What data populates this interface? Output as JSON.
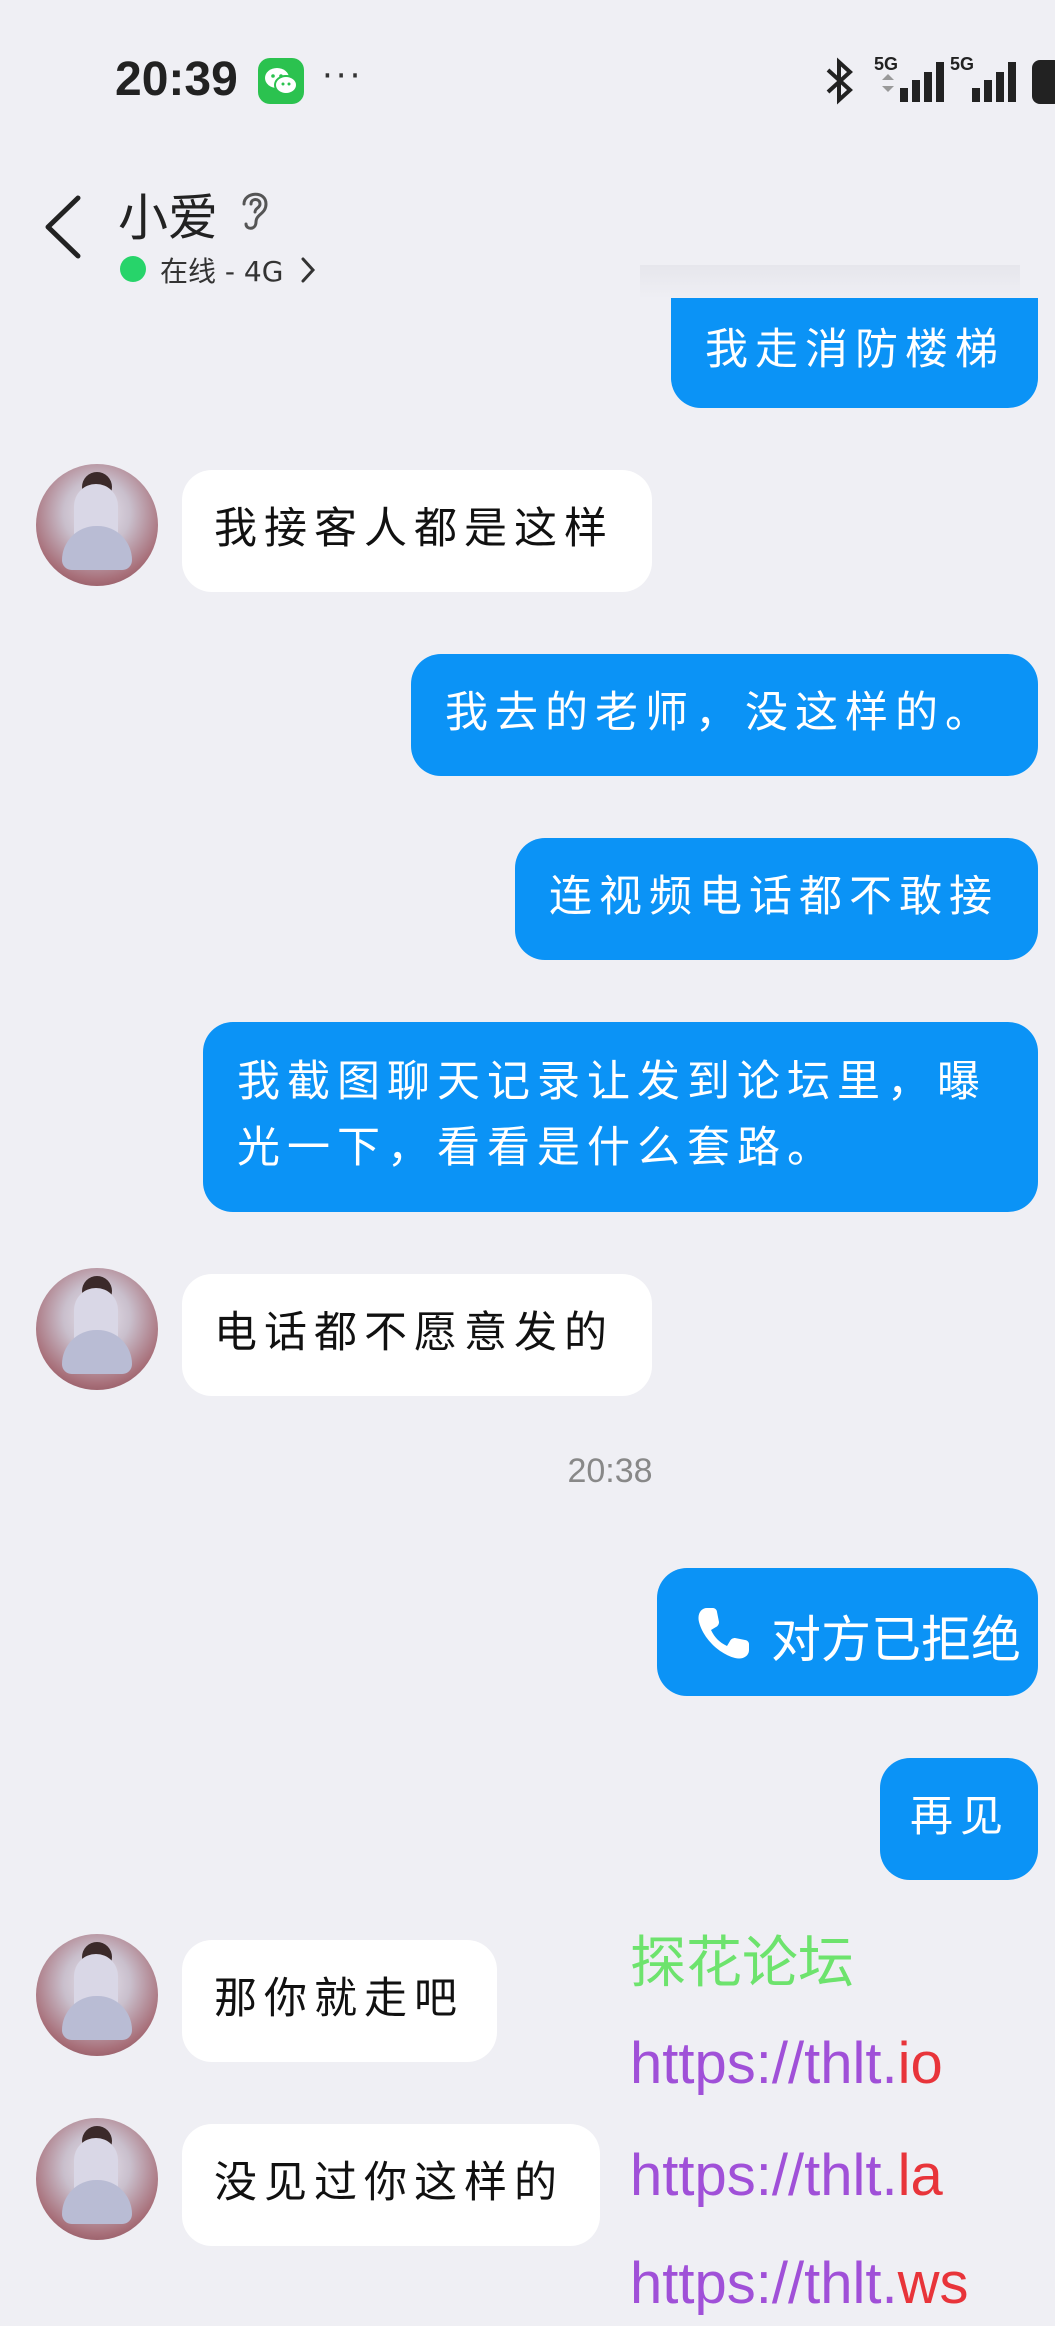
{
  "status_bar": {
    "time": "20:39",
    "dots": "···",
    "network_1": "5G",
    "network_2": "5G"
  },
  "header": {
    "contact_name": "小爱",
    "status": "在线 - 4G"
  },
  "messages": [
    {
      "direction": "out",
      "lines": [
        "我走消防楼梯"
      ]
    },
    {
      "direction": "in",
      "lines": [
        "我接客人都是这样"
      ]
    },
    {
      "direction": "out",
      "lines": [
        "我去的老师，没这样的。"
      ]
    },
    {
      "direction": "out",
      "lines": [
        "连视频电话都不敢接"
      ]
    },
    {
      "direction": "out",
      "lines": [
        "我截图聊天记录让发到论坛里，曝",
        "光一下，看看是什么套路。"
      ]
    },
    {
      "direction": "in",
      "lines": [
        "电话都不愿意发的"
      ]
    },
    {
      "direction": "out",
      "lines": [
        "再见"
      ]
    },
    {
      "direction": "in",
      "lines": [
        "那你就走吧"
      ]
    },
    {
      "direction": "in",
      "lines": [
        "没见过你这样的"
      ]
    }
  ],
  "timestamp": "20:38",
  "call": {
    "label": "对方已拒绝"
  },
  "watermark": {
    "title": "探花论坛",
    "urls": [
      {
        "prefix": "https://thlt.",
        "suffix": "io"
      },
      {
        "prefix": "https://thlt.",
        "suffix": "la"
      },
      {
        "prefix": "https://thlt.",
        "suffix": "ws"
      }
    ]
  },
  "colors": {
    "background": "#efeff4",
    "outgoing_bubble": "#0b93f6",
    "incoming_bubble": "#ffffff",
    "online_dot": "#27d46a",
    "wechat_green": "#2bc24f"
  }
}
